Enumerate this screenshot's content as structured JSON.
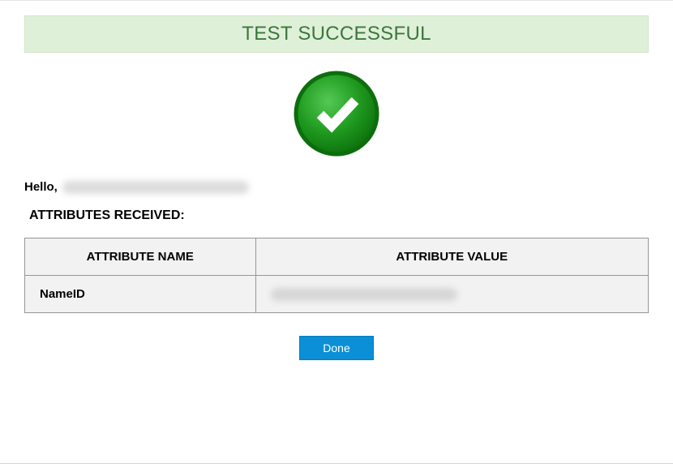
{
  "banner": {
    "title": "TEST SUCCESSFUL"
  },
  "greeting": {
    "prefix": "Hello, "
  },
  "attributes_section": {
    "label": "ATTRIBUTES RECEIVED:"
  },
  "table": {
    "headers": {
      "name": "ATTRIBUTE NAME",
      "value": "ATTRIBUTE VALUE"
    },
    "rows": [
      {
        "name": "NameID"
      }
    ]
  },
  "actions": {
    "done_label": "Done"
  },
  "colors": {
    "banner_bg": "#dff0d8",
    "banner_text": "#3c763d",
    "button_bg": "#0b8fd6",
    "button_text": "#ffffff",
    "check_fill": "#1a8f1a"
  }
}
